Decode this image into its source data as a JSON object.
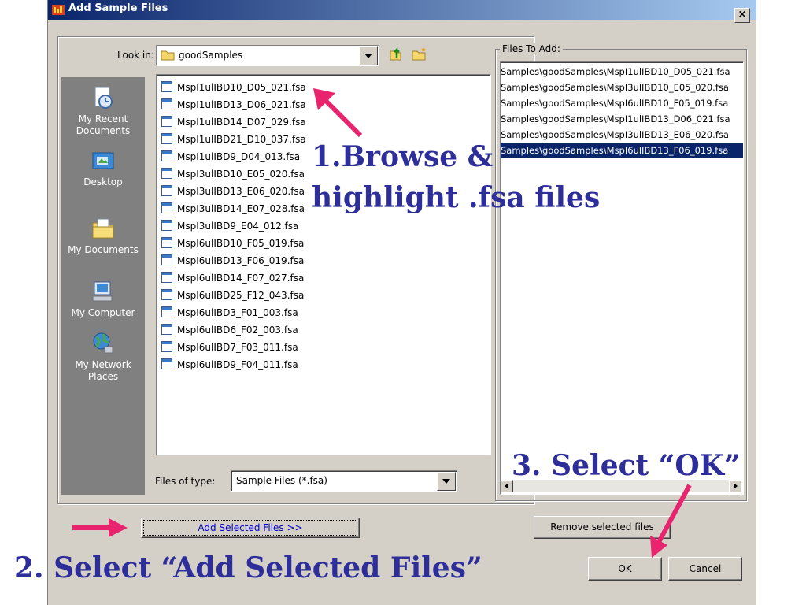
{
  "window": {
    "title": "Add Sample Files",
    "close_label": "×"
  },
  "look_in": {
    "label": "Look in:",
    "value": "goodSamples"
  },
  "places": [
    {
      "name": "recent",
      "label": "My Recent Documents"
    },
    {
      "name": "desktop",
      "label": "Desktop"
    },
    {
      "name": "documents",
      "label": "My Documents"
    },
    {
      "name": "computer",
      "label": "My Computer"
    },
    {
      "name": "network",
      "label": "My Network Places"
    }
  ],
  "files": [
    "MspI1ulIBD10_D05_021.fsa",
    "MspI1ulIBD13_D06_021.fsa",
    "MspI1ulIBD14_D07_029.fsa",
    "MspI1ulIBD21_D10_037.fsa",
    "MspI1ulIBD9_D04_013.fsa",
    "MspI3ulIBD10_E05_020.fsa",
    "MspI3ulIBD13_E06_020.fsa",
    "MspI3ulIBD14_E07_028.fsa",
    "MspI3ulIBD9_E04_012.fsa",
    "MspI6ulIBD10_F05_019.fsa",
    "MspI6ulIBD13_F06_019.fsa",
    "MspI6ulIBD14_F07_027.fsa",
    "MspI6ulIBD25_F12_043.fsa",
    "MspI6ulIBD3_F01_003.fsa",
    "MspI6ulIBD6_F02_003.fsa",
    "MspI6ulIBD7_F03_011.fsa",
    "MspI6ulIBD9_F04_011.fsa"
  ],
  "files_of_type": {
    "label": "Files of type:",
    "value": "Sample Files (*.fsa)"
  },
  "files_to_add": {
    "label": "Files To Add:",
    "items": [
      "Samples\\goodSamples\\MspI1ulIBD10_D05_021.fsa",
      "Samples\\goodSamples\\MspI3ulIBD10_E05_020.fsa",
      "Samples\\goodSamples\\MspI6ulIBD10_F05_019.fsa",
      "Samples\\goodSamples\\MspI1ulIBD13_D06_021.fsa",
      "Samples\\goodSamples\\MspI3ulIBD13_E06_020.fsa",
      "Samples\\goodSamples\\MspI6ulIBD13_F06_019.fsa"
    ]
  },
  "buttons": {
    "add_selected": "Add Selected Files >>",
    "remove_selected": "Remove selected files",
    "ok": "OK",
    "cancel": "Cancel"
  },
  "annotations": {
    "step1_line1": "1.Browse &",
    "step1_line2": "highlight .fsa files",
    "step2": "2.  Select “Add Selected Files”",
    "step3": "3.  Select “OK”"
  },
  "colors": {
    "annotation_text": "#2e2e9a",
    "arrow": "#e8246e",
    "selection": "#0a246a"
  }
}
